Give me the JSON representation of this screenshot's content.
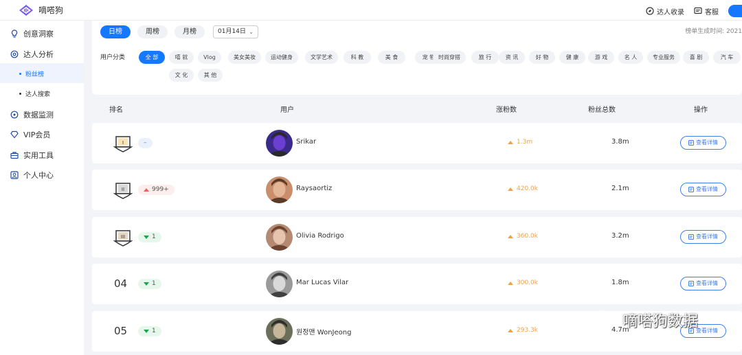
{
  "app": {
    "name": "嘀嗒狗"
  },
  "top_actions": {
    "collect": "达人收录",
    "service": "客服"
  },
  "sidebar": {
    "items": [
      {
        "label": "创意洞察",
        "icon": "bulb-icon"
      },
      {
        "label": "达人分析",
        "icon": "settings-icon"
      },
      {
        "label": "数据监测",
        "icon": "monitor-icon"
      },
      {
        "label": "VIP会员",
        "icon": "diamond-icon"
      },
      {
        "label": "实用工具",
        "icon": "toolbox-icon"
      },
      {
        "label": "个人中心",
        "icon": "user-icon"
      }
    ],
    "sub_items": [
      {
        "label": "粉丝榜",
        "active": true
      },
      {
        "label": "达人搜索",
        "active": false
      }
    ]
  },
  "filters": {
    "tabs": [
      {
        "label": "日榜",
        "active": true
      },
      {
        "label": "周榜",
        "active": false
      },
      {
        "label": "月榜",
        "active": false
      }
    ],
    "date": "01月14日",
    "gen_time": "榜单生成时间: 2021",
    "category_label": "用户分类",
    "categories_row1": [
      "全 部",
      "嘻 就",
      "Vlog",
      "美女美妆",
      "运动健身",
      "文学艺术",
      "科 教",
      "美 食",
      "宠 物",
      "时尚穿搭",
      "旅 行",
      "资 讯",
      "好 物",
      "健 康",
      "游 戏",
      "名 人",
      "专业服务",
      "喜 剧",
      "汽 车"
    ],
    "categories_row2": [
      "文 化",
      "其 他"
    ]
  },
  "table": {
    "headers": {
      "rank": "排名",
      "user": "用户",
      "gain": "涨粉数",
      "total": "粉丝总数",
      "action": "操作"
    },
    "action_label": "查看详情",
    "rows": [
      {
        "rank_badge": "I",
        "rank": "",
        "change_type": "neutral",
        "change": "–",
        "name": "Srikar",
        "gain": "1.3m",
        "total": "3.8m"
      },
      {
        "rank_badge": "II",
        "rank": "",
        "change_type": "up",
        "change": "999+",
        "name": "Raysaortiz",
        "gain": "420.0k",
        "total": "2.1m"
      },
      {
        "rank_badge": "III",
        "rank": "",
        "change_type": "down",
        "change": "1",
        "name": "Olivia Rodrigo",
        "gain": "360.0k",
        "total": "3.2m"
      },
      {
        "rank_badge": "",
        "rank": "04",
        "change_type": "down",
        "change": "1",
        "name": "Mar Lucas Vilar",
        "gain": "300.0k",
        "total": "1.8m"
      },
      {
        "rank_badge": "",
        "rank": "05",
        "change_type": "down",
        "change": "1",
        "name": "원정맨 WonJeong",
        "gain": "293.3k",
        "total": "4.7m"
      }
    ]
  },
  "watermark": "嘀嗒狗数据",
  "colors": {
    "primary": "#1677ff",
    "gain": "#f0a248",
    "up": "#e8625f",
    "down": "#1fa350"
  }
}
